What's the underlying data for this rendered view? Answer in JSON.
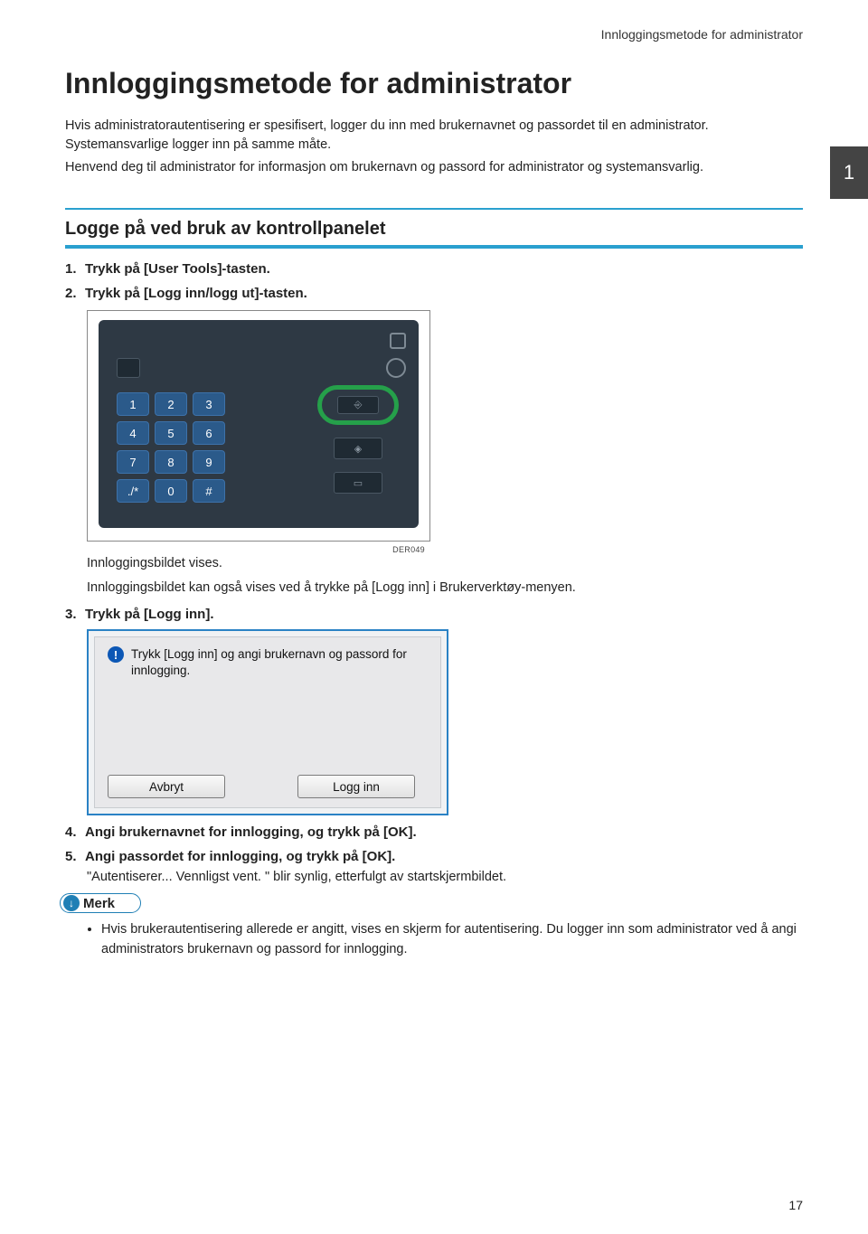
{
  "header": {
    "running_title": "Innloggingsmetode for administrator"
  },
  "chapter_tab": "1",
  "title": "Innloggingsmetode for administrator",
  "intro": [
    "Hvis administratorautentisering er spesifisert, logger du inn med brukernavnet og passordet til en administrator. Systemansvarlige logger inn på samme måte.",
    "Henvend deg til administrator for informasjon om brukernavn og passord for administrator og systemansvarlig."
  ],
  "section_heading": "Logge på ved bruk av kontrollpanelet",
  "steps": {
    "s1": {
      "num": "1.",
      "text": "Trykk på [User Tools]-tasten."
    },
    "s2": {
      "num": "2.",
      "text": "Trykk på [Logg inn/logg ut]-tasten.",
      "fig_code": "DER049",
      "after": [
        "Innloggingsbildet vises.",
        "Innloggingsbildet kan også vises ved å trykke på [Logg inn] i Brukerverktøy-menyen."
      ]
    },
    "s3": {
      "num": "3.",
      "text": "Trykk på [Logg inn].",
      "screen_msg": "Trykk [Logg inn] og angi brukernavn og passord for innlogging.",
      "btn_cancel": "Avbryt",
      "btn_login": "Logg inn"
    },
    "s4": {
      "num": "4.",
      "text": "Angi brukernavnet for innlogging, og trykk på [OK]."
    },
    "s5": {
      "num": "5.",
      "text": "Angi passordet for innlogging, og trykk på [OK].",
      "after": "\"Autentiserer... Vennligst vent. \" blir synlig, etterfulgt av startskjermbildet."
    }
  },
  "keypad": [
    "1",
    "2",
    "3",
    "4",
    "5",
    "6",
    "7",
    "8",
    "9",
    "./*",
    "0",
    "#"
  ],
  "note": {
    "label": "Merk",
    "items": [
      "Hvis brukerautentisering allerede er angitt, vises en skjerm for autentisering. Du logger inn som administrator ved å angi administrators brukernavn og passord for innlogging."
    ]
  },
  "page_number": "17"
}
